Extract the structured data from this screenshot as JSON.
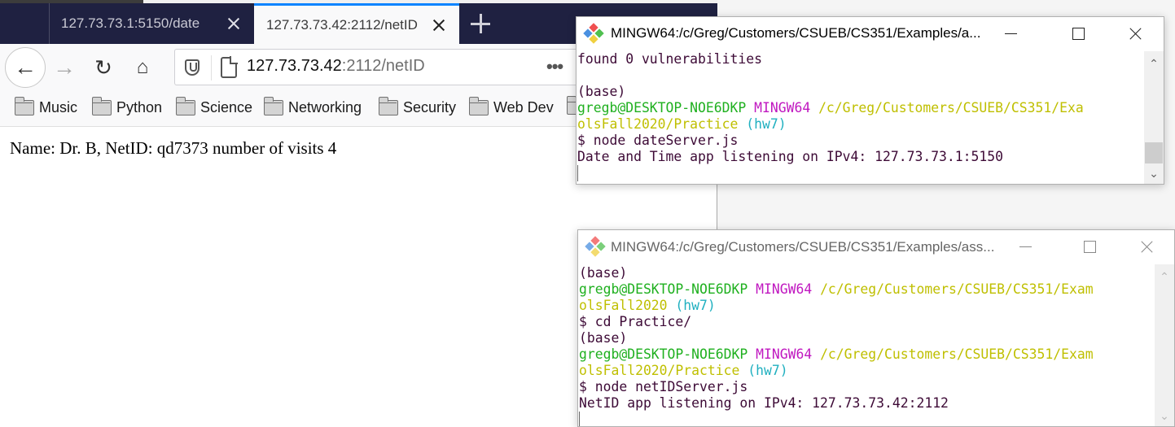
{
  "browser": {
    "tabs": [
      {
        "title": "127.73.73.1:5150/date",
        "active": false
      },
      {
        "title": "127.73.73.42:2112/netID",
        "active": true
      }
    ],
    "url": {
      "host": "127.73.73.42",
      "rest": ":2112/netID"
    },
    "url_more": "•••",
    "nav_icons": {
      "back": "←",
      "forward": "→",
      "reload": "↻",
      "home": "⌂"
    },
    "bookmarks": [
      "Music",
      "Python",
      "Science",
      "Networking",
      "Security",
      "Web Dev"
    ],
    "page_text": "Name: Dr. B, NetID: qd7373 number of visits 4"
  },
  "terminals": [
    {
      "title": "MINGW64:/c/Greg/Customers/CSUEB/CS351/Examples/a...",
      "focused": true,
      "lines": [
        [
          {
            "t": "found 0 vulnerabilities",
            "c": "def"
          }
        ],
        [
          {
            "t": "",
            "c": "def"
          }
        ],
        [
          {
            "t": "(base)",
            "c": "def"
          }
        ],
        [
          {
            "t": "gregb@DESKTOP-NOE6DKP ",
            "c": "green"
          },
          {
            "t": "MINGW64 ",
            "c": "mag"
          },
          {
            "t": "/c/Greg/Customers/CSUEB/CS351/Exa",
            "c": "yel"
          }
        ],
        [
          {
            "t": "olsFall2020/Practice ",
            "c": "yel"
          },
          {
            "t": "(hw7)",
            "c": "cyan"
          }
        ],
        [
          {
            "t": "$ node dateServer.js",
            "c": "def"
          }
        ],
        [
          {
            "t": "Date and Time app listening on IPv4: 127.73.73.1:5150",
            "c": "def"
          }
        ]
      ]
    },
    {
      "title": "MINGW64:/c/Greg/Customers/CSUEB/CS351/Examples/ass...",
      "focused": false,
      "lines": [
        [
          {
            "t": "(base)",
            "c": "def"
          }
        ],
        [
          {
            "t": "gregb@DESKTOP-NOE6DKP ",
            "c": "green"
          },
          {
            "t": "MINGW64 ",
            "c": "mag"
          },
          {
            "t": "/c/Greg/Customers/CSUEB/CS351/Exam",
            "c": "yel"
          }
        ],
        [
          {
            "t": "olsFall2020 ",
            "c": "yel"
          },
          {
            "t": "(hw7)",
            "c": "cyan"
          }
        ],
        [
          {
            "t": "$ cd Practice/",
            "c": "def"
          }
        ],
        [
          {
            "t": "(base)",
            "c": "def"
          }
        ],
        [
          {
            "t": "gregb@DESKTOP-NOE6DKP ",
            "c": "green"
          },
          {
            "t": "MINGW64 ",
            "c": "mag"
          },
          {
            "t": "/c/Greg/Customers/CSUEB/CS351/Exam",
            "c": "yel"
          }
        ],
        [
          {
            "t": "olsFall2020/Practice ",
            "c": "yel"
          },
          {
            "t": "(hw7)",
            "c": "cyan"
          }
        ],
        [
          {
            "t": "$ node netIDServer.js",
            "c": "def"
          }
        ],
        [
          {
            "t": "NetID app listening on IPv4: 127.73.73.42:2112",
            "c": "def"
          }
        ]
      ]
    }
  ],
  "scroll_icons": {
    "up": "⌃",
    "down": "⌄"
  },
  "colors": {
    "tabbar_bg": "#1f2141",
    "active_tab_accent": "#0a84ff",
    "term_default": "#3d0a36",
    "term_green": "#1fb01f",
    "term_magenta": "#c018c0",
    "term_yellow": "#bfbf00",
    "term_cyan": "#20b0c0"
  }
}
